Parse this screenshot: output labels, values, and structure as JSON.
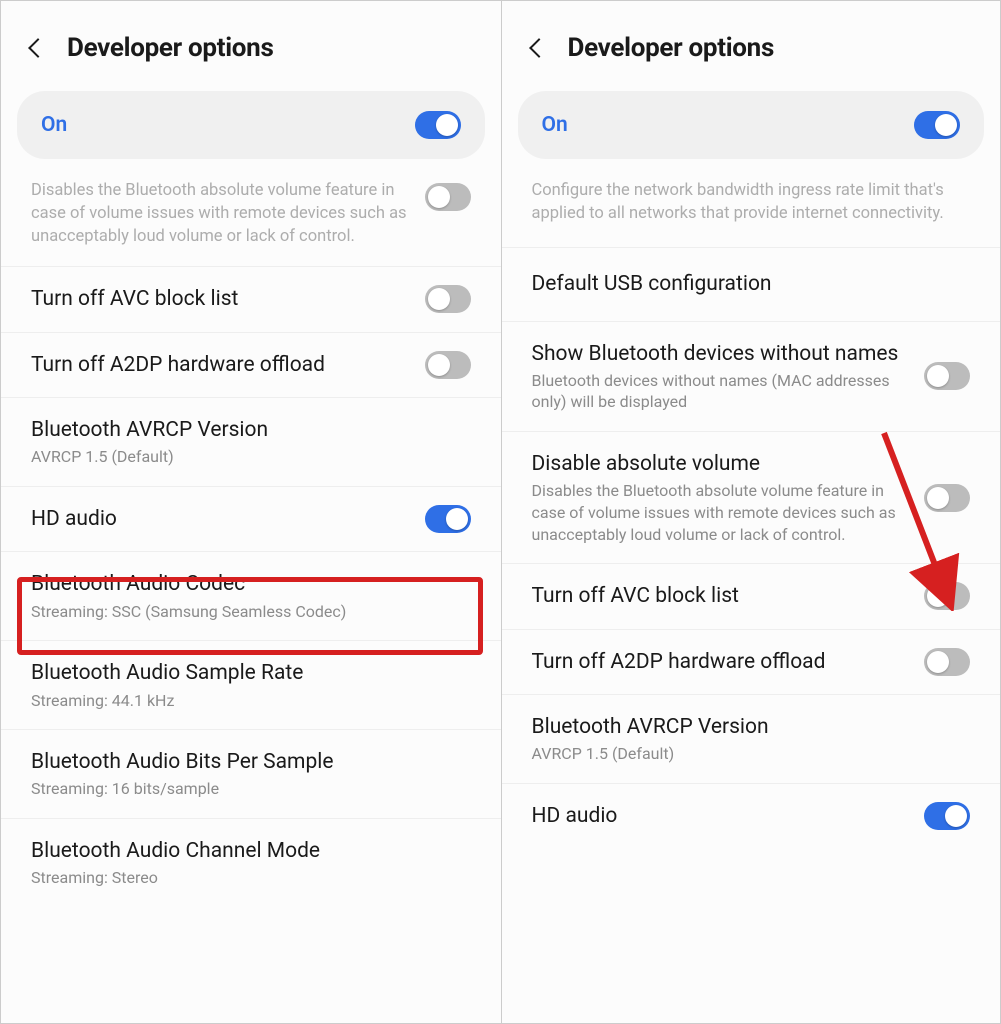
{
  "left": {
    "header_title": "Developer options",
    "master_label": "On",
    "partial_desc": "Disables the Bluetooth absolute volume feature in case of volume issues with remote devices such as unacceptably loud volume or lack of control.",
    "rows": [
      {
        "label": "Turn off AVC block list",
        "sub": "",
        "toggle": "off"
      },
      {
        "label": "Turn off A2DP hardware offload",
        "sub": "",
        "toggle": "off"
      },
      {
        "label": "Bluetooth AVRCP Version",
        "sub": "AVRCP 1.5 (Default)",
        "toggle": ""
      },
      {
        "label": "HD audio",
        "sub": "",
        "toggle": "on"
      },
      {
        "label": "Bluetooth Audio Codec",
        "sub": "Streaming: SSC (Samsung Seamless Codec)",
        "toggle": ""
      },
      {
        "label": "Bluetooth Audio Sample Rate",
        "sub": "Streaming: 44.1 kHz",
        "toggle": ""
      },
      {
        "label": "Bluetooth Audio Bits Per Sample",
        "sub": "Streaming: 16 bits/sample",
        "toggle": ""
      },
      {
        "label": "Bluetooth Audio Channel Mode",
        "sub": "Streaming: Stereo",
        "toggle": ""
      }
    ]
  },
  "right": {
    "header_title": "Developer options",
    "master_label": "On",
    "partial_desc": "Configure the network bandwidth ingress rate limit that's applied to all networks that provide internet connectivity.",
    "rows": [
      {
        "label": "Default USB configuration",
        "sub": "",
        "toggle": ""
      },
      {
        "label": "Show Bluetooth devices without names",
        "sub": "Bluetooth devices without names (MAC addresses only) will be displayed",
        "toggle": "off"
      },
      {
        "label": "Disable absolute volume",
        "sub": "Disables the Bluetooth absolute volume feature in case of volume issues with remote devices such as unacceptably loud volume or lack of control.",
        "toggle": "off"
      },
      {
        "label": "Turn off AVC block list",
        "sub": "",
        "toggle": "off"
      },
      {
        "label": "Turn off A2DP hardware offload",
        "sub": "",
        "toggle": "off"
      },
      {
        "label": "Bluetooth AVRCP Version",
        "sub": "AVRCP 1.5 (Default)",
        "toggle": ""
      },
      {
        "label": "HD audio",
        "sub": "",
        "toggle": "on"
      }
    ]
  }
}
